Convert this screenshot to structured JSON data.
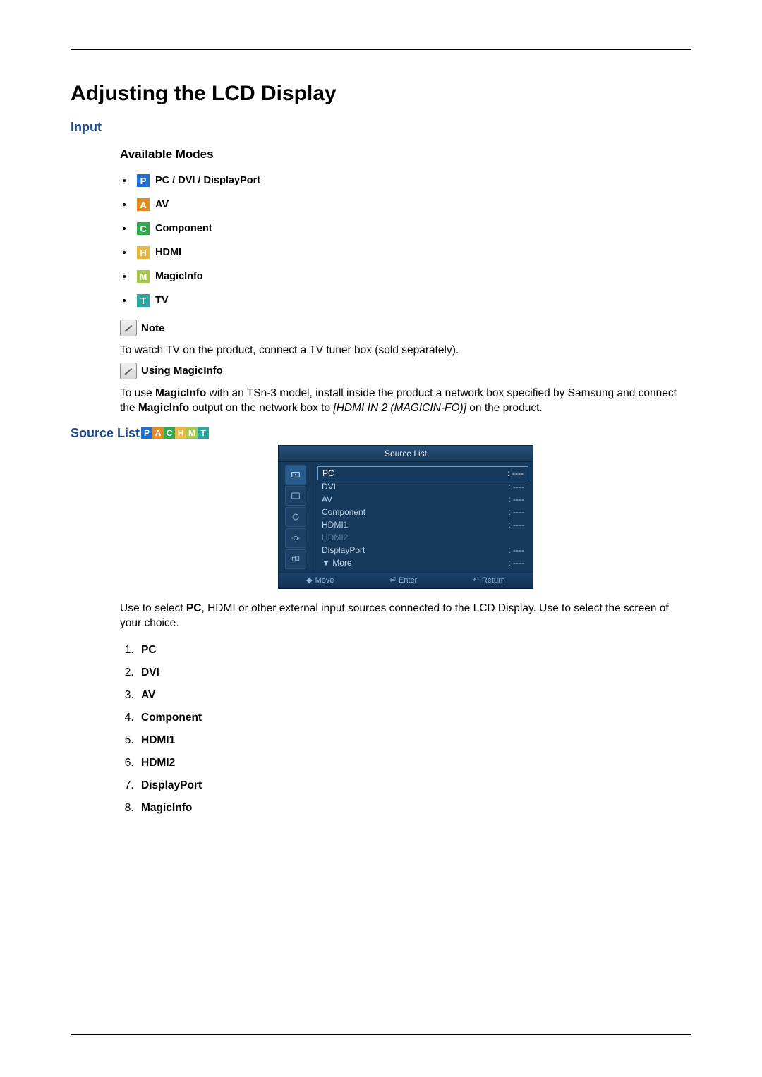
{
  "page_title": "Adjusting the LCD Display",
  "section_input": "Input",
  "available_modes_heading": "Available Modes",
  "modes": [
    {
      "badge": "P",
      "label": "PC / DVI / DisplayPort"
    },
    {
      "badge": "A",
      "label": "AV"
    },
    {
      "badge": "C",
      "label": "Component"
    },
    {
      "badge": "H",
      "label": "HDMI"
    },
    {
      "badge": "M",
      "label": "MagicInfo"
    },
    {
      "badge": "T",
      "label": "TV"
    }
  ],
  "note_label": "Note",
  "note_text": "To watch TV on the product, connect a TV tuner box (sold separately).",
  "using_magicinfo_label": "Using MagicInfo",
  "magicinfo_text": {
    "pre": "To use ",
    "bold1": "MagicInfo",
    "mid1": " with an TSn-3 model, install inside the product a network box specified by Samsung and connect the ",
    "bold2": "MagicInfo",
    "mid2": " output on the network box to ",
    "italic": "[HDMI IN 2 (MAGICIN-FO)]",
    "post": " on the product."
  },
  "source_list_heading": "Source List",
  "source_badges": [
    "P",
    "A",
    "C",
    "H",
    "M",
    "T"
  ],
  "osd": {
    "title": "Source List",
    "rows": [
      {
        "label": "PC",
        "value": ": ‑‑‑‑",
        "sel": true
      },
      {
        "label": "DVI",
        "value": ": ‑‑‑‑"
      },
      {
        "label": "AV",
        "value": ": ‑‑‑‑"
      },
      {
        "label": "Component",
        "value": ": ‑‑‑‑"
      },
      {
        "label": "HDMI1",
        "value": ": ‑‑‑‑"
      },
      {
        "label": "HDMI2",
        "value": "",
        "muted": true
      },
      {
        "label": "DisplayPort",
        "value": ": ‑‑‑‑"
      },
      {
        "label": "▼ More",
        "value": ": ‑‑‑‑"
      }
    ],
    "foot": {
      "move": "Move",
      "enter": "Enter",
      "return": "Return"
    }
  },
  "source_desc": {
    "pre": "Use to select ",
    "bold": "PC",
    "post": ", HDMI or other external input sources connected to the LCD Display. Use to select the screen of your choice."
  },
  "numbered": [
    "PC",
    "DVI",
    "AV",
    "Component",
    "HDMI1",
    "HDMI2",
    "DisplayPort",
    "MagicInfo"
  ]
}
